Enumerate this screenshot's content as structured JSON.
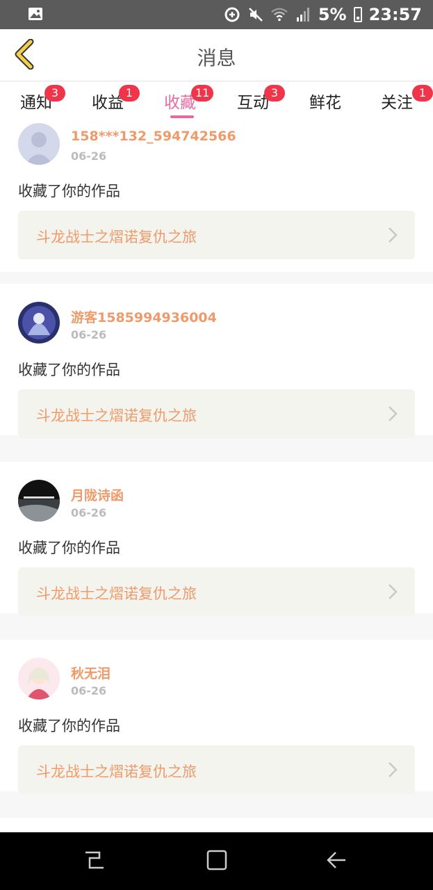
{
  "status_bar": {
    "battery": "5%",
    "time": "23:57",
    "icons": [
      "image-icon",
      "data-saver-icon",
      "mute-icon",
      "wifi-icon",
      "signal-icon",
      "battery-icon"
    ]
  },
  "header": {
    "title": "消息",
    "back_icon": "chevron-left-icon"
  },
  "tabs": [
    {
      "label": "通知",
      "badge": "3"
    },
    {
      "label": "收益",
      "badge": "1"
    },
    {
      "label": "收藏",
      "badge": "11",
      "active": true
    },
    {
      "label": "互动",
      "badge": "3"
    },
    {
      "label": "鲜花",
      "badge": ""
    },
    {
      "label": "关注",
      "badge": "1"
    }
  ],
  "messages": [
    {
      "user": "158***132_594742566",
      "date": "06-26",
      "action": "收藏了你的作品",
      "work": "斗龙战士之熠诺复仇之旅",
      "avatar": "default-avatar"
    },
    {
      "user": "游客1585994936004",
      "date": "06-26",
      "action": "收藏了你的作品",
      "work": "斗龙战士之熠诺复仇之旅",
      "avatar": "blue-anime-avatar"
    },
    {
      "user": "月陇诗函",
      "date": "06-26",
      "action": "收藏了你的作品",
      "work": "斗龙战士之熠诺复仇之旅",
      "avatar": "dark-avatar"
    },
    {
      "user": "秋无泪",
      "date": "06-26",
      "action": "收藏了你的作品",
      "work": "斗龙战士之熠诺复仇之旅",
      "avatar": "pink-anime-avatar"
    }
  ],
  "colors": {
    "accent": "#e86aa2",
    "name": "#ef9a6a",
    "badge": "#f0344a",
    "back": "#f2d04a"
  },
  "nav_bar": {
    "icons": [
      "recent-apps-icon",
      "home-icon",
      "back-arrow-icon"
    ]
  }
}
